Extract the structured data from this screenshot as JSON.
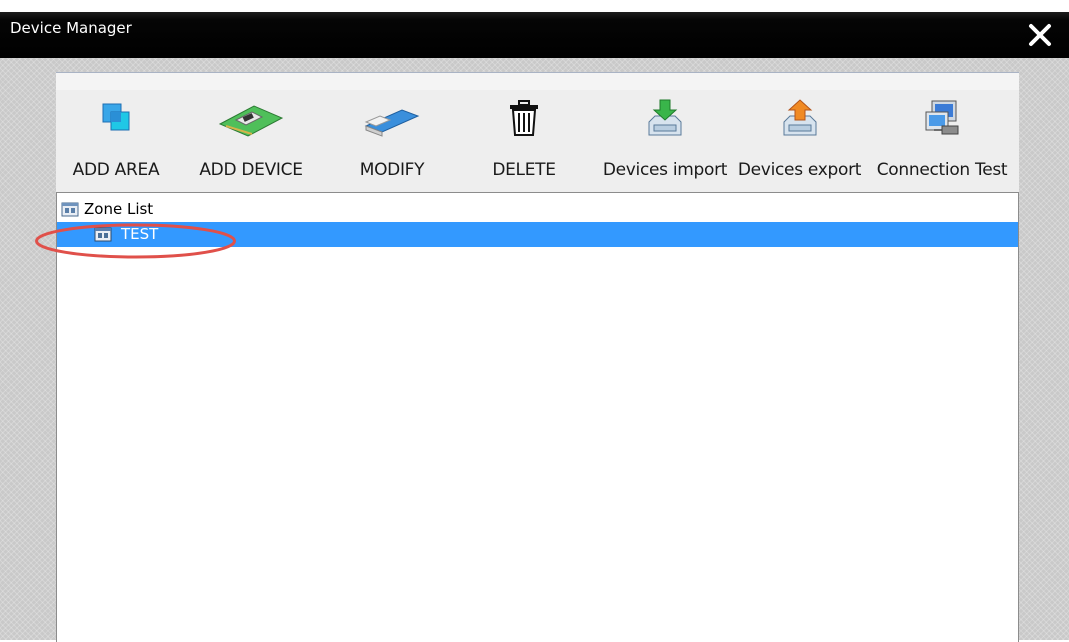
{
  "window": {
    "title": "Device Manager",
    "close_glyph": "✕"
  },
  "toolbar": {
    "items": [
      {
        "label": "ADD AREA",
        "icon": "add-area-icon"
      },
      {
        "label": "ADD DEVICE",
        "icon": "add-device-icon"
      },
      {
        "label": "MODIFY",
        "icon": "modify-icon"
      },
      {
        "label": "DELETE",
        "icon": "trash-icon"
      },
      {
        "label": "Devices import",
        "icon": "import-icon"
      },
      {
        "label": "Devices export",
        "icon": "export-icon"
      },
      {
        "label": "Connection Test",
        "icon": "connection-test-icon"
      }
    ]
  },
  "tree": {
    "root": {
      "label": "Zone List",
      "icon": "zone-folder-icon"
    },
    "children": [
      {
        "label": "TEST",
        "icon": "zone-folder-icon",
        "selected": true
      }
    ]
  },
  "colors": {
    "selection": "#3399ff",
    "annotation": "#e0504a"
  }
}
